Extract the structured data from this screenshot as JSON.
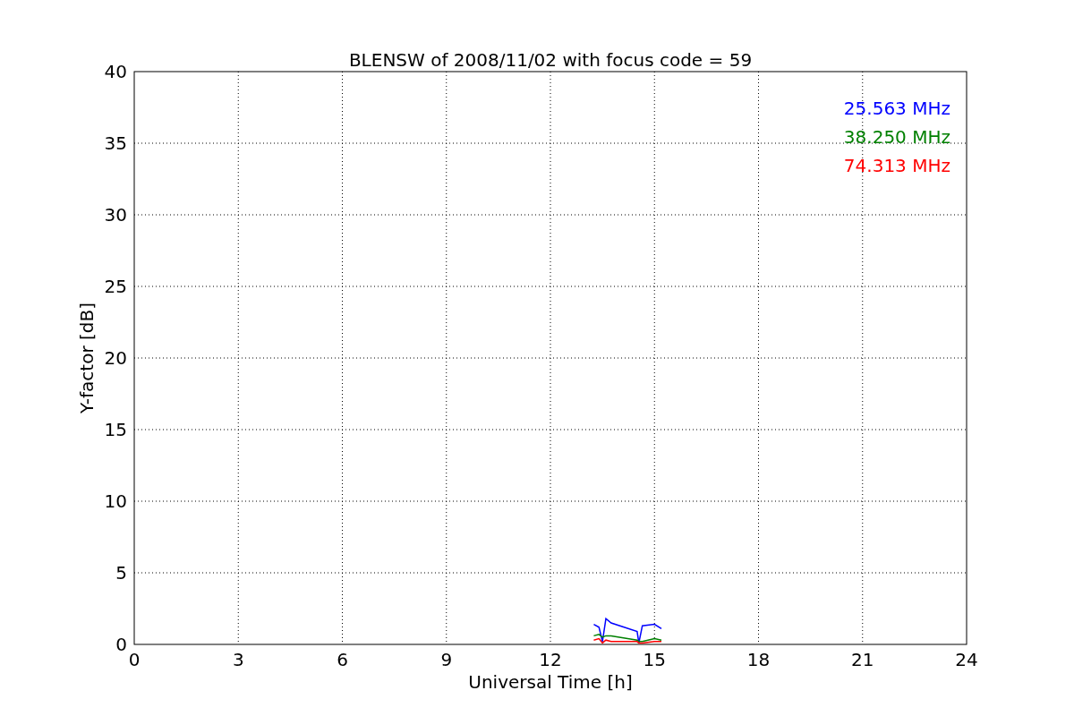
{
  "chart_data": {
    "type": "line",
    "title": "BLENSW of 2008/11/02 with focus code = 59",
    "xlabel": "Universal Time [h]",
    "ylabel": "Y-factor [dB]",
    "x": [
      13.25,
      13.4,
      13.5,
      13.6,
      13.75,
      14.5,
      14.55,
      14.65,
      15.0,
      15.2
    ],
    "series": [
      {
        "name": "25.563 MHz",
        "color": "#0000ff",
        "values": [
          1.4,
          1.2,
          0.2,
          1.8,
          1.5,
          0.9,
          0.1,
          1.3,
          1.4,
          1.1
        ]
      },
      {
        "name": "38.250 MHz",
        "color": "#008000",
        "values": [
          0.6,
          0.7,
          0.5,
          0.6,
          0.6,
          0.3,
          0.2,
          0.2,
          0.4,
          0.3
        ]
      },
      {
        "name": "74.313 MHz",
        "color": "#ff0000",
        "values": [
          0.3,
          0.4,
          0.1,
          0.3,
          0.2,
          0.2,
          0.1,
          0.1,
          0.2,
          0.2
        ]
      }
    ],
    "xlim": [
      0,
      24
    ],
    "ylim": [
      0,
      40
    ],
    "xticks": [
      0,
      3,
      6,
      9,
      12,
      15,
      18,
      21,
      24
    ],
    "yticks": [
      0,
      5,
      10,
      15,
      20,
      25,
      30,
      35,
      40
    ],
    "grid": true
  }
}
